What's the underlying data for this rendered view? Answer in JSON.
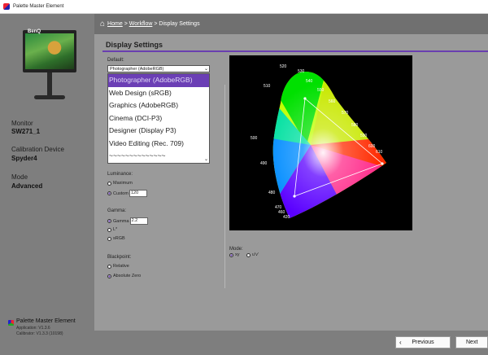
{
  "window": {
    "title": "Palette Master Element"
  },
  "sidebar": {
    "brand": "BenQ",
    "monitor_label": "Monitor",
    "monitor_value": "SW271_1",
    "device_label": "Calibration Device",
    "device_value": "Spyder4",
    "mode_label": "Mode",
    "mode_value": "Advanced",
    "footer_name": "Palette Master Element",
    "footer_app_version": "Application: V1.3.6",
    "footer_cal_version": "Calibrator: V1.3.3 (10198)"
  },
  "breadcrumb": {
    "home": "Home",
    "sep1": ">",
    "workflow": "Workflow",
    "sep2": ">",
    "current": "Display Settings"
  },
  "main": {
    "section_title": "Display Settings",
    "default_label": "Default:",
    "default_selected": "Photographer (AdobeRGB)",
    "options": [
      "Photographer (AdobeRGB)",
      "Web Design (sRGB)",
      "Graphics (AdobeRGB)",
      "Cinema (DCI-P3)",
      "Designer (Display P3)",
      "Video Editing (Rec. 709)",
      "~~~~~~~~~~~~~~"
    ],
    "luminance_label": "Luminance:",
    "luminance_max": "Maximum",
    "luminance_custom": "Custom",
    "luminance_value": "120",
    "gamma_label": "Gamma:",
    "gamma_gamma": "Gamma",
    "gamma_value": "2.2",
    "gamma_lstar": "L*",
    "gamma_srgb": "sRGB",
    "blackpoint_label": "Blackpoint:",
    "blackpoint_relative": "Relative",
    "blackpoint_absolute": "Absolute Zero",
    "mode_label": "Mode:",
    "mode_xy": "xy",
    "mode_uv": "u'v'"
  },
  "chart_labels": [
    "520",
    "530",
    "540",
    "510",
    "550",
    "560",
    "570",
    "580",
    "590",
    "500",
    "600",
    "610",
    "490",
    "480",
    "470",
    "460",
    "420"
  ],
  "buttons": {
    "previous": "Previous",
    "next": "Next"
  },
  "colors": {
    "accent": "#6b3fb5",
    "sidebar": "#7e7e7e",
    "main": "#9a9a9a"
  }
}
